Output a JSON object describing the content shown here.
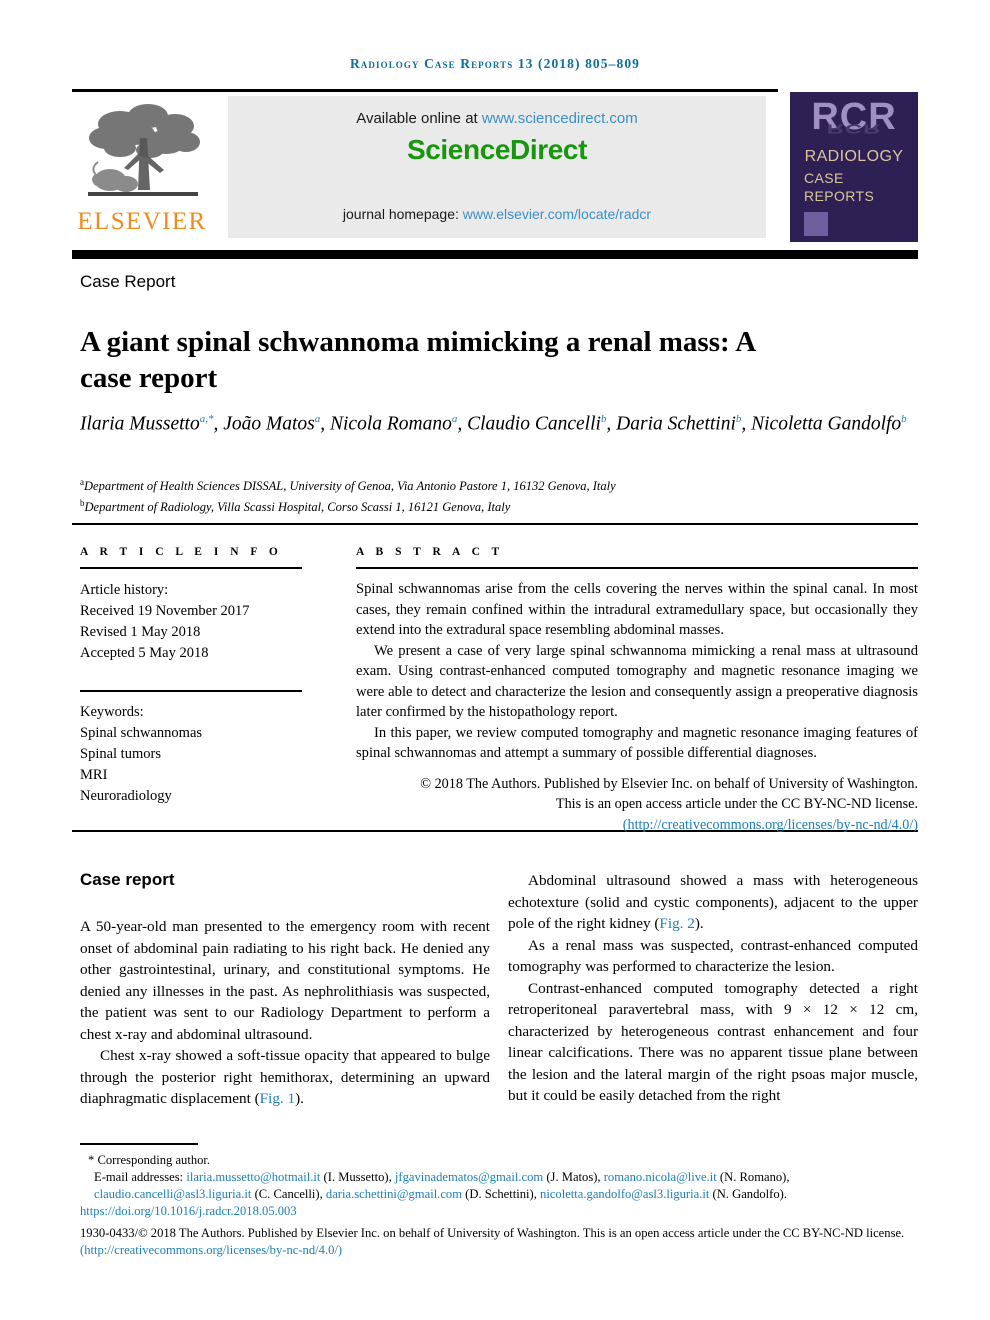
{
  "running_head": "Radiology Case Reports 13 (2018) 805–809",
  "header": {
    "publisher_name": "ELSEVIER",
    "available_label": "Available online at ",
    "available_link": "www.sciencedirect.com",
    "sciencedirect_logo": "ScienceDirect",
    "homepage_label": "journal homepage: ",
    "homepage_link": "www.elsevier.com/locate/radcr",
    "cover": {
      "acronym": "RCR",
      "line1": "RADIOLOGY",
      "line2": "CASE",
      "line3": "REPORTS"
    }
  },
  "article": {
    "kicker": "Case Report",
    "title": "A giant spinal schwannoma mimicking a renal mass: A case report",
    "authors_html": "Ilaria Mussetto<sup>a,*</sup>, João Matos<sup>a</sup>, Nicola Romano<sup>a</sup>, Claudio Cancelli<sup>b</sup>, Daria Schettini<sup>b</sup>, Nicoletta Gandolfo<sup>b</sup>",
    "affiliation_a": "Department of Health Sciences DISSAL, University of Genoa, Via Antonio Pastore 1, 16132 Genova, Italy",
    "affiliation_b": "Department of Radiology, Villa Scassi Hospital, Corso Scassi 1, 16121 Genova, Italy"
  },
  "article_info": {
    "heading": "A R T I C L E   I N F O",
    "history_label": "Article history:",
    "received": "Received 19 November 2017",
    "revised": "Revised 1 May 2018",
    "accepted": "Accepted 5 May 2018",
    "keywords_label": "Keywords:",
    "keywords": [
      "Spinal schwannomas",
      "Spinal tumors",
      "MRI",
      "Neuroradiology"
    ]
  },
  "abstract": {
    "heading": "A B S T R A C T",
    "paragraphs": [
      "Spinal schwannomas arise from the cells covering the nerves within the spinal canal. In most cases, they remain confined within the intradural extramedullary space, but occasionally they extend into the extradural space resembling abdominal masses.",
      "We present a case of very large spinal schwannoma mimicking a renal mass at ultrasound exam. Using contrast-enhanced computed tomography and magnetic resonance imaging we were able to detect and characterize the lesion and consequently assign a preoperative diagnosis later confirmed by the histopathology report.",
      "In this paper, we review computed tomography and magnetic resonance imaging features of spinal schwannomas and attempt a summary of possible differential diagnoses."
    ],
    "copyright_line1": "© 2018 The Authors. Published by Elsevier Inc. on behalf of University of Washington.",
    "copyright_line2": "This is an open access article under the CC BY-NC-ND license.",
    "copyright_link": "(http://creativecommons.org/licenses/by-nc-nd/4.0/)"
  },
  "body": {
    "section_heading": "Case report",
    "left_paragraphs": [
      "A 50-year-old man presented to the emergency room with recent onset of abdominal pain radiating to his right back. He denied any other gastrointestinal, urinary, and constitutional symptoms. He denied any illnesses in the past. As nephrolithiasis was suspected, the patient was sent to our Radiology Department to perform a chest x-ray and abdominal ultrasound.",
      "Chest x-ray showed a soft-tissue opacity that appeared to bulge through the posterior right hemithorax, determining an upward diaphragmatic displacement (Fig. 1)."
    ],
    "left_figref": "Fig. 1",
    "right_paragraphs": [
      "Abdominal ultrasound showed a mass with heterogeneous echotexture (solid and cystic components), adjacent to the upper pole of the right kidney (Fig. 2).",
      "As a renal mass was suspected, contrast-enhanced computed tomography was performed to characterize the lesion.",
      "Contrast-enhanced computed tomography detected a right retroperitoneal paravertebral mass, with 9 × 12 × 12 cm, characterized by heterogeneous contrast enhancement and four linear calcifications. There was no apparent tissue plane between the lesion and the lateral margin of the right psoas major muscle, but it could be easily detached from the right"
    ],
    "right_figref": "Fig. 2"
  },
  "footer": {
    "corresponding": "* Corresponding author.",
    "email_label": "E-mail addresses: ",
    "emails": [
      {
        "address": "ilaria.mussetto@hotmail.it",
        "name": " (I. Mussetto), "
      },
      {
        "address": "jfgavinadematos@gmail.com",
        "name": " (J. Matos), "
      },
      {
        "address": "romano.nicola@live.it",
        "name": " (N. Romano), "
      },
      {
        "address": "claudio.cancelli@asl3.liguria.it",
        "name": " (C. Cancelli), "
      },
      {
        "address": "daria.schettini@gmail.com",
        "name": " (D. Schettini), "
      },
      {
        "address": "nicoletta.gandolfo@asl3.liguria.it",
        "name": " (N. Gandolfo)."
      }
    ],
    "doi": "https://doi.org/10.1016/j.radcr.2018.05.003",
    "license_text": "1930-0433/© 2018 The Authors. Published by Elsevier Inc. on behalf of University of Washington. This is an open access article under the CC BY-NC-ND license. ",
    "license_link": "(http://creativecommons.org/licenses/by-nc-nd/4.0/)"
  },
  "colors": {
    "running_head": "#0b6e9e",
    "link": "#1d7fb8",
    "sciencedirect_green": "#17960e",
    "elsevier_orange": "#f08a1c",
    "cover_purple": "#2e1f55",
    "cover_cream": "#d8c89a"
  }
}
